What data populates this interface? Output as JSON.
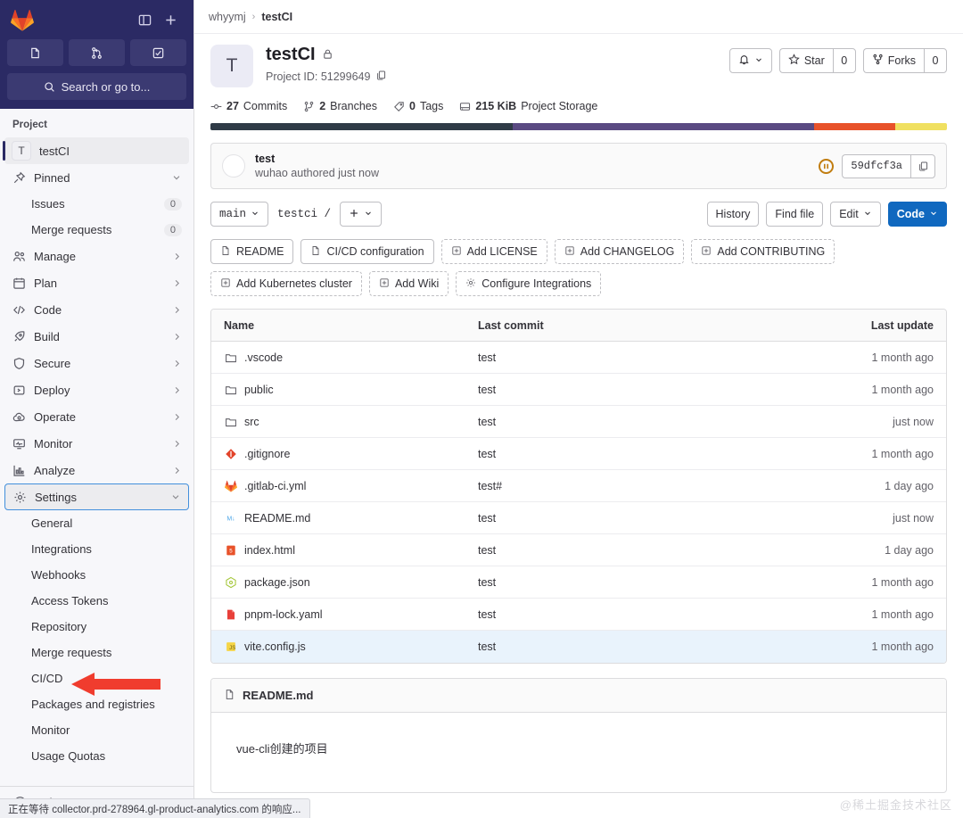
{
  "sidebar": {
    "brand_icon": "gitlab-logo",
    "top_actions": [
      {
        "name": "toggle-sidebar-icon",
        "icon": "sidebar-panel"
      },
      {
        "name": "new-item-icon",
        "icon": "plus"
      }
    ],
    "icon_buttons": [
      {
        "name": "issues-shortcut",
        "icon": "issue-book"
      },
      {
        "name": "merge-requests-shortcut",
        "icon": "merge-request"
      },
      {
        "name": "todos-shortcut",
        "icon": "todo-check"
      }
    ],
    "search_placeholder": "Search or go to...",
    "section_label": "Project",
    "project": {
      "initial": "T",
      "name": "testCI"
    },
    "pinned": {
      "label": "Pinned",
      "items": [
        {
          "label": "Issues",
          "count": "0"
        },
        {
          "label": "Merge requests",
          "count": "0"
        }
      ]
    },
    "nav": [
      {
        "label": "Manage",
        "icon": "users-icon"
      },
      {
        "label": "Plan",
        "icon": "calendar-icon"
      },
      {
        "label": "Code",
        "icon": "code-icon"
      },
      {
        "label": "Build",
        "icon": "rocket-icon"
      },
      {
        "label": "Secure",
        "icon": "shield-icon"
      },
      {
        "label": "Deploy",
        "icon": "deploy-icon"
      },
      {
        "label": "Operate",
        "icon": "cloud-gear-icon"
      },
      {
        "label": "Monitor",
        "icon": "monitor-icon"
      },
      {
        "label": "Analyze",
        "icon": "chart-icon"
      }
    ],
    "settings": {
      "label": "Settings",
      "icon": "gear-icon"
    },
    "settings_items": [
      "General",
      "Integrations",
      "Webhooks",
      "Access Tokens",
      "Repository",
      "Merge requests",
      "CI/CD",
      "Packages and registries",
      "Monitor",
      "Usage Quotas"
    ],
    "help_label": "Help"
  },
  "breadcrumb": {
    "group": "whyymj",
    "separator": "›",
    "project": "testCI"
  },
  "project": {
    "avatar_initial": "T",
    "name": "testCI",
    "visibility_icon": "lock-icon",
    "id_label": "Project ID: 51299649",
    "copy_icon": "copy-icon",
    "stats": [
      {
        "icon": "commit-icon",
        "value": "27",
        "label": "Commits"
      },
      {
        "icon": "branch-icon",
        "value": "2",
        "label": "Branches"
      },
      {
        "icon": "tag-icon",
        "value": "0",
        "label": "Tags"
      },
      {
        "icon": "storage-icon",
        "value": "215 KiB",
        "label": "Project Storage"
      }
    ],
    "actions": {
      "notification_icon": "bell-icon",
      "star_label": "Star",
      "star_count": "0",
      "fork_label": "Forks",
      "fork_count": "0"
    }
  },
  "language_bar": [
    {
      "name": "lang-1",
      "color": "#2f3b47",
      "percent": 41
    },
    {
      "name": "lang-2",
      "color": "#5a4a82",
      "percent": 41
    },
    {
      "name": "lang-3",
      "color": "#e8522a",
      "percent": 11
    },
    {
      "name": "lang-4",
      "color": "#f0e060",
      "percent": 7
    }
  ],
  "last_commit": {
    "title": "test",
    "subtitle": "wuhao authored just now",
    "ci_status_icon": "pipeline-paused-icon",
    "sha": "59dfcf3a",
    "copy_icon": "copy-icon"
  },
  "repo_toolbar": {
    "branch": "main",
    "path": "testci /",
    "add_icon": "plus",
    "history_label": "History",
    "find_file_label": "Find file",
    "edit_label": "Edit",
    "code_label": "Code"
  },
  "quick_actions_row1": [
    {
      "label": "README",
      "icon": "file-icon",
      "dashed": false
    },
    {
      "label": "CI/CD configuration",
      "icon": "file-icon",
      "dashed": false
    },
    {
      "label": "Add LICENSE",
      "icon": "plus-square-icon",
      "dashed": true
    },
    {
      "label": "Add CHANGELOG",
      "icon": "plus-square-icon",
      "dashed": true
    },
    {
      "label": "Add CONTRIBUTING",
      "icon": "plus-square-icon",
      "dashed": true
    }
  ],
  "quick_actions_row2": [
    {
      "label": "Add Kubernetes cluster",
      "icon": "plus-square-icon",
      "dashed": true
    },
    {
      "label": "Add Wiki",
      "icon": "plus-square-icon",
      "dashed": true
    },
    {
      "label": "Configure Integrations",
      "icon": "gear-icon",
      "dashed": true
    }
  ],
  "file_table": {
    "headers": {
      "name": "Name",
      "commit": "Last commit",
      "update": "Last update"
    },
    "rows": [
      {
        "name": ".vscode",
        "type": "folder",
        "commit": "test",
        "update": "1 month ago",
        "highlight": false
      },
      {
        "name": "public",
        "type": "folder",
        "commit": "test",
        "update": "1 month ago",
        "highlight": false
      },
      {
        "name": "src",
        "type": "folder",
        "commit": "test",
        "update": "just now",
        "highlight": false
      },
      {
        "name": ".gitignore",
        "type": "git",
        "commit": "test",
        "update": "1 month ago",
        "highlight": false
      },
      {
        "name": ".gitlab-ci.yml",
        "type": "gitlab",
        "commit": "test#",
        "update": "1 day ago",
        "highlight": false
      },
      {
        "name": "README.md",
        "type": "markdown",
        "commit": "test",
        "update": "just now",
        "highlight": false
      },
      {
        "name": "index.html",
        "type": "html",
        "commit": "test",
        "update": "1 day ago",
        "highlight": false
      },
      {
        "name": "package.json",
        "type": "npm",
        "commit": "test",
        "update": "1 month ago",
        "highlight": false
      },
      {
        "name": "pnpm-lock.yaml",
        "type": "yaml",
        "commit": "test",
        "update": "1 month ago",
        "highlight": false
      },
      {
        "name": "vite.config.js",
        "type": "js",
        "commit": "test",
        "update": "1 month ago",
        "highlight": true
      }
    ]
  },
  "readme": {
    "icon": "file-icon",
    "filename": "README.md",
    "body": "vue-cli创建的项目"
  },
  "watermark": "@稀土掘金技术社区",
  "statusbar": "正在等待 collector.prd-278964.gl-product-analytics.com 的响应...",
  "annotation": {
    "name": "red-arrow-annotation",
    "color": "#f03c2e",
    "points_to": "CI/CD"
  }
}
